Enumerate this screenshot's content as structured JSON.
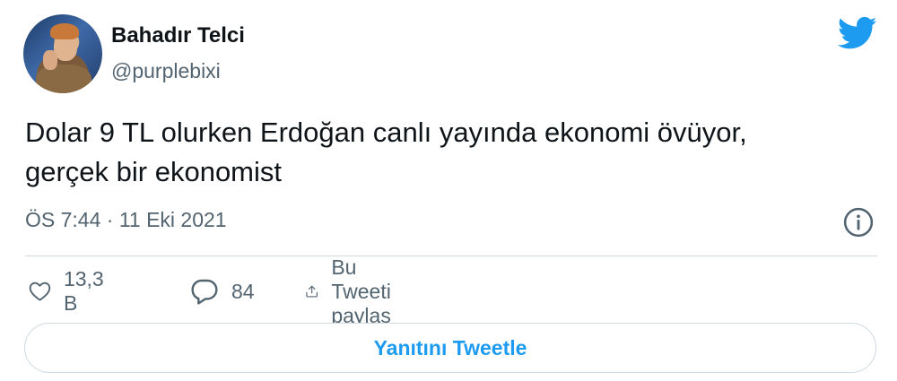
{
  "author": {
    "name": "Bahadır Telci",
    "handle": "@purplebixi"
  },
  "tweet": {
    "text_line1": "Dolar 9 TL olurken Erdoğan canlı yayında ekonomi övüyor,",
    "text_line2": "gerçek bir ekonomist",
    "timestamp": "ÖS 7:44 · 11 Eki 2021"
  },
  "actions": {
    "likes": "13,3 B",
    "replies": "84",
    "share_label": "Bu Tweeti paylaş"
  },
  "reply_button_label": "Yanıtını Tweetle",
  "colors": {
    "accent": "#1d9bf0",
    "secondary_text": "#536471",
    "primary_text": "#0f1419",
    "border": "#cfd9de"
  },
  "icons": [
    "twitter-bird-icon",
    "info-icon",
    "heart-icon",
    "reply-icon",
    "share-icon"
  ]
}
